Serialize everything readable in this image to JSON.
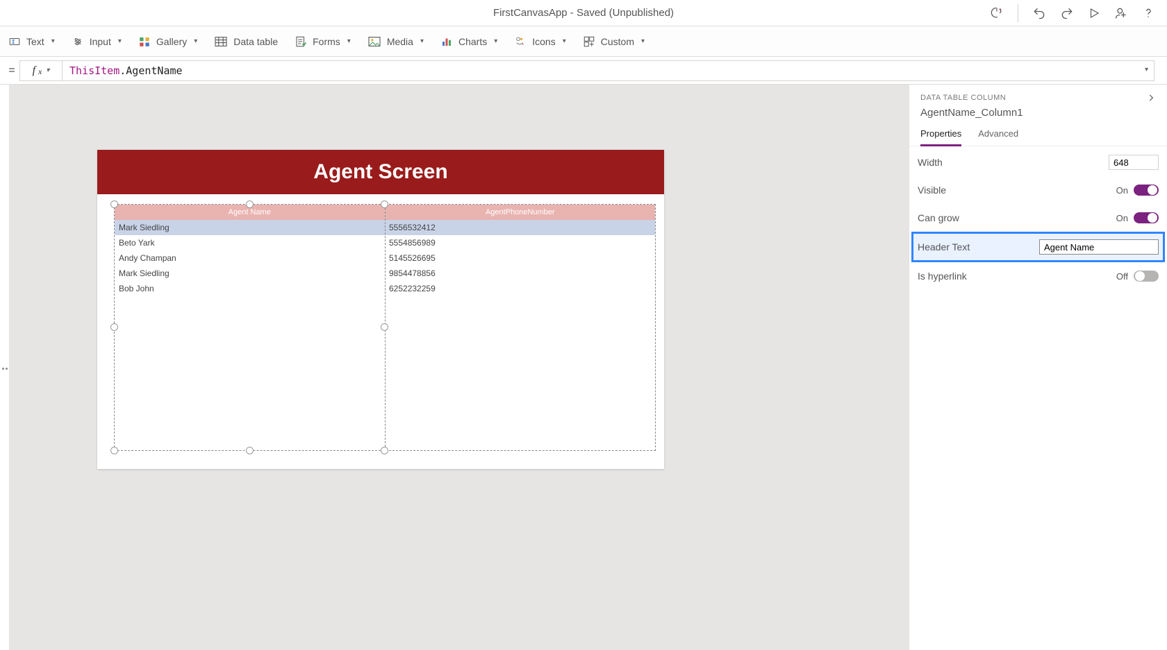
{
  "titlebar": {
    "title": "FirstCanvasApp - Saved (Unpublished)"
  },
  "ribbon": {
    "text_label": "Text",
    "input_label": "Input",
    "gallery_label": "Gallery",
    "datatable_label": "Data table",
    "forms_label": "Forms",
    "media_label": "Media",
    "charts_label": "Charts",
    "icons_label": "Icons",
    "custom_label": "Custom"
  },
  "formula": {
    "prefix": "ThisItem",
    "suffix": ".AgentName"
  },
  "canvas": {
    "screen_title": "Agent Screen",
    "columns": [
      "Agent Name",
      "AgentPhoneNumber"
    ],
    "rows": [
      {
        "name": "Mark Siedling",
        "phone": "5556532412"
      },
      {
        "name": "Beto Yark",
        "phone": "5554856989"
      },
      {
        "name": "Andy Champan",
        "phone": "5145526695"
      },
      {
        "name": "Mark Siedling",
        "phone": "9854478856"
      },
      {
        "name": "Bob John",
        "phone": "6252232259"
      }
    ]
  },
  "props": {
    "section_label": "DATA TABLE COLUMN",
    "column_name": "AgentName_Column1",
    "tab_properties": "Properties",
    "tab_advanced": "Advanced",
    "width_label": "Width",
    "width_value": "648",
    "visible_label": "Visible",
    "visible_state": "On",
    "cangrow_label": "Can grow",
    "cangrow_state": "On",
    "header_label": "Header Text",
    "header_value": "Agent Name",
    "hyperlink_label": "Is hyperlink",
    "hyperlink_state": "Off"
  }
}
